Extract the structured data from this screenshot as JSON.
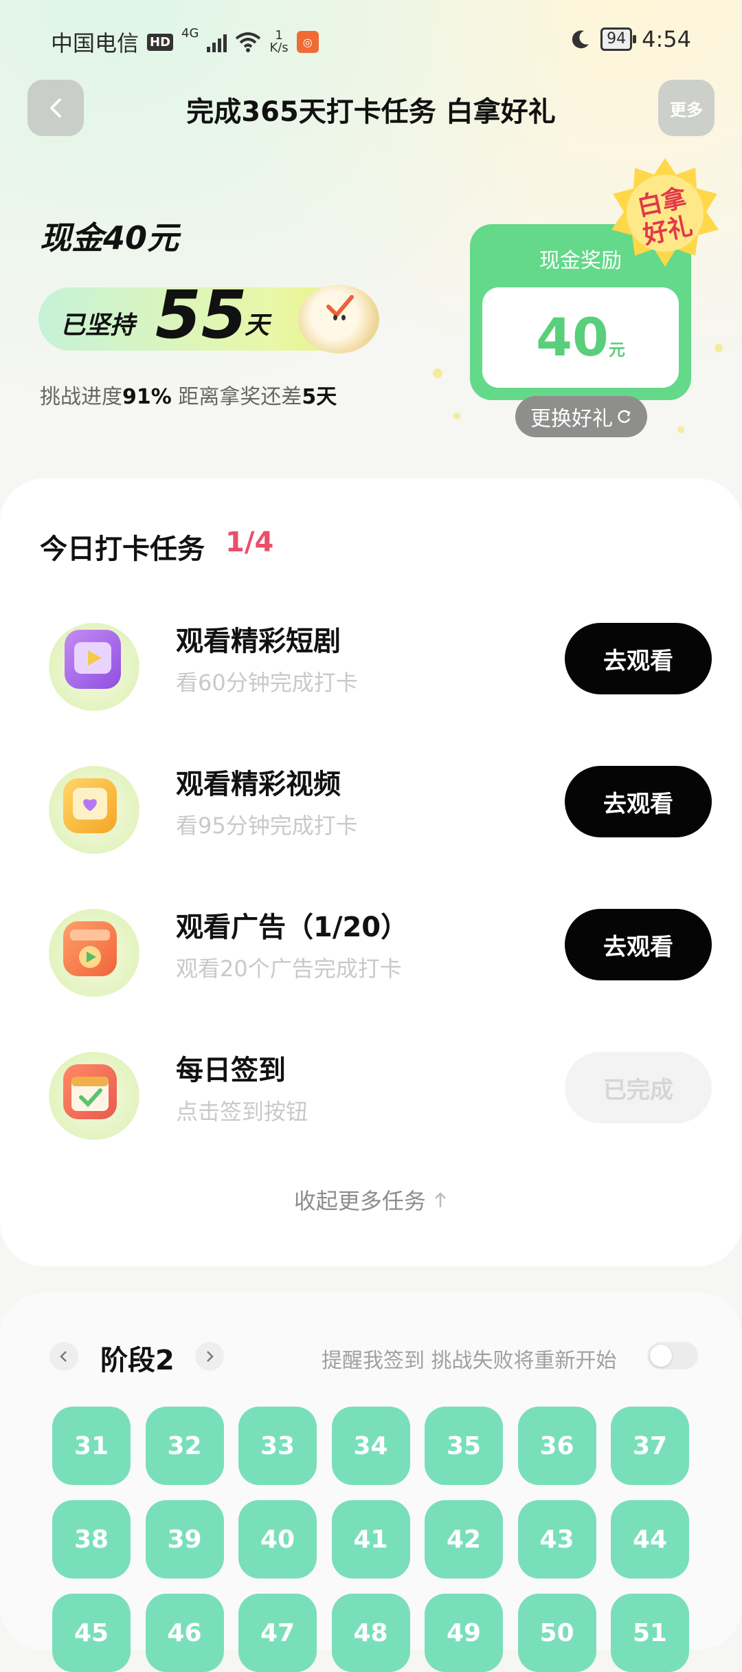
{
  "status_bar": {
    "carrier": "中国电信",
    "hd": "HD",
    "network": "4G",
    "speed_value": "1",
    "speed_unit": "K/s",
    "battery": "94",
    "time": "4:54"
  },
  "header": {
    "title": "完成365天打卡任务 白拿好礼",
    "more_label": "更多",
    "back_icon": "chevron-left-icon"
  },
  "hero": {
    "cash_title": "现金40元",
    "days_prefix": "已坚持",
    "days_count": "55",
    "days_suffix": "天",
    "progress_label": "挑战进度",
    "progress_value": "91%",
    "remaining_label": "距离拿奖还差",
    "remaining_value": "5天",
    "progress_fraction": 0.91
  },
  "reward": {
    "label": "现金奖励",
    "amount": "40",
    "unit": "元",
    "badge_line1": "白拿",
    "badge_line2": "好礼",
    "switch_label": "更换好礼",
    "switch_icon": "refresh-icon"
  },
  "tasks": {
    "title": "今日打卡任务",
    "count": "1/4",
    "items": [
      {
        "title": "观看精彩短剧",
        "subtitle": "看60分钟完成打卡",
        "button": "去观看",
        "icon": "tv-play-icon"
      },
      {
        "title": "观看精彩视频",
        "subtitle": "看95分钟完成打卡",
        "button": "去观看",
        "icon": "video-frame-icon"
      },
      {
        "title": "观看广告（1/20）",
        "subtitle": "观看20个广告完成打卡",
        "button": "去观看",
        "icon": "ad-box-icon"
      },
      {
        "title": "每日签到",
        "subtitle": "点击签到按钮",
        "button": "已完成",
        "icon": "calendar-check-icon"
      }
    ],
    "collapse_label": "收起更多任务",
    "collapse_icon": "arrow-up-icon"
  },
  "stage": {
    "label": "阶段2",
    "reminder": "提醒我签到 挑战失败将重新开始",
    "reminder_on": false,
    "days": [
      "31",
      "32",
      "33",
      "34",
      "35",
      "36",
      "37",
      "38",
      "39",
      "40",
      "41",
      "42",
      "43",
      "44",
      "45",
      "46",
      "47",
      "48",
      "49",
      "50",
      "51"
    ]
  },
  "colors": {
    "accent_green": "#64d98a",
    "day_cell": "#79dfba",
    "count_red": "#e94f6a"
  }
}
